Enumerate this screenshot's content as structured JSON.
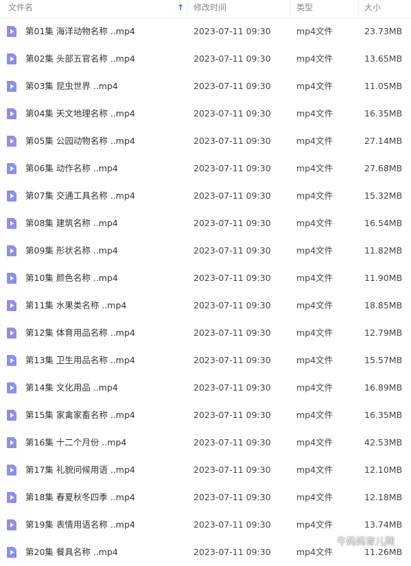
{
  "columns": {
    "name": "文件名",
    "modified": "修改时间",
    "type": "类型",
    "size": "大小"
  },
  "sort": {
    "column": "name",
    "direction": "ascending",
    "icon": "sort-up-arrow-icon",
    "color": "#1a73e8"
  },
  "file_icon": {
    "name": "video-file-icon",
    "color": "#8b8ef0"
  },
  "files": [
    {
      "name": "第01集 海洋动物名称 ..mp4",
      "modified": "2023-07-11 09:30",
      "type": "mp4文件",
      "size": "23.73MB"
    },
    {
      "name": "第02集 头部五官名称 ..mp4",
      "modified": "2023-07-11 09:30",
      "type": "mp4文件",
      "size": "13.65MB"
    },
    {
      "name": "第03集 昆虫世界 ..mp4",
      "modified": "2023-07-11 09:30",
      "type": "mp4文件",
      "size": "11.05MB"
    },
    {
      "name": "第04集 天文地理名称 ..mp4",
      "modified": "2023-07-11 09:30",
      "type": "mp4文件",
      "size": "16.35MB"
    },
    {
      "name": "第05集 公园动物名称 ..mp4",
      "modified": "2023-07-11 09:30",
      "type": "mp4文件",
      "size": "27.14MB"
    },
    {
      "name": "第06集 动作名称 ..mp4",
      "modified": "2023-07-11 09:30",
      "type": "mp4文件",
      "size": "27.68MB"
    },
    {
      "name": "第07集 交通工具名称 ..mp4",
      "modified": "2023-07-11 09:30",
      "type": "mp4文件",
      "size": "15.32MB"
    },
    {
      "name": "第08集 建筑名称 ..mp4",
      "modified": "2023-07-11 09:30",
      "type": "mp4文件",
      "size": "16.54MB"
    },
    {
      "name": "第09集 形状名称 ..mp4",
      "modified": "2023-07-11 09:30",
      "type": "mp4文件",
      "size": "11.82MB"
    },
    {
      "name": "第10集 颜色名称 ..mp4",
      "modified": "2023-07-11 09:30",
      "type": "mp4文件",
      "size": "11.90MB"
    },
    {
      "name": "第11集 水果类名称 ..mp4",
      "modified": "2023-07-11 09:30",
      "type": "mp4文件",
      "size": "18.85MB"
    },
    {
      "name": "第12集 体育用品名称 ..mp4",
      "modified": "2023-07-11 09:30",
      "type": "mp4文件",
      "size": "12.79MB"
    },
    {
      "name": "第13集 卫生用品名称 ..mp4",
      "modified": "2023-07-11 09:30",
      "type": "mp4文件",
      "size": "15.57MB"
    },
    {
      "name": "第14集 文化用品 ..mp4",
      "modified": "2023-07-11 09:30",
      "type": "mp4文件",
      "size": "16.89MB"
    },
    {
      "name": "第15集 家禽家畜名称 ..mp4",
      "modified": "2023-07-11 09:30",
      "type": "mp4文件",
      "size": "16.35MB"
    },
    {
      "name": "第16集 十二个月份 ..mp4",
      "modified": "2023-07-11 09:30",
      "type": "mp4文件",
      "size": "42.53MB"
    },
    {
      "name": "第17集 礼貌问候用语 ..mp4",
      "modified": "2023-07-11 09:30",
      "type": "mp4文件",
      "size": "12.10MB"
    },
    {
      "name": "第18集 春夏秋冬四季 ..mp4",
      "modified": "2023-07-11 09:30",
      "type": "mp4文件",
      "size": "12.18MB"
    },
    {
      "name": "第19集 表情用语名称 ..mp4",
      "modified": "2023-07-11 09:30",
      "type": "mp4文件",
      "size": "13.74MB"
    },
    {
      "name": "第20集 餐具名称 ..mp4",
      "modified": "2023-07-11 09:30",
      "type": "mp4文件",
      "size": "11.26MB"
    }
  ],
  "watermark": {
    "text": "牛妈妈育儿网",
    "icon": "wechat-icon"
  }
}
